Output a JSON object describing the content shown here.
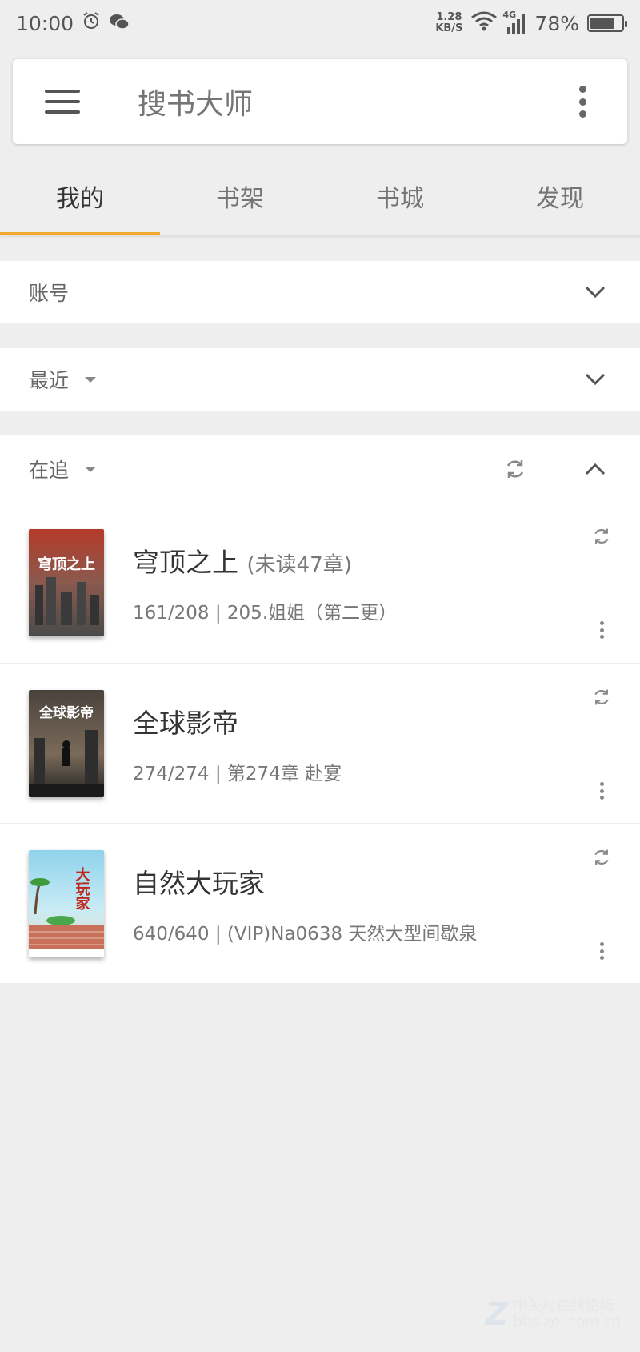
{
  "status_bar": {
    "time": "10:00",
    "net_speed_value": "1.28",
    "net_speed_unit": "KB/S",
    "network": "4G",
    "battery": "78%",
    "battery_level": 0.78
  },
  "header": {
    "title": "搜书大师"
  },
  "tabs": [
    {
      "label": "我的",
      "active": true
    },
    {
      "label": "书架",
      "active": false
    },
    {
      "label": "书城",
      "active": false
    },
    {
      "label": "发现",
      "active": false
    }
  ],
  "sections": {
    "account": {
      "label": "账号"
    },
    "recent": {
      "label": "最近"
    },
    "following": {
      "label": "在追"
    }
  },
  "books": [
    {
      "title": "穹顶之上",
      "unread": "(未读47章)",
      "progress": "161/208 | 205.姐姐（第二更）",
      "cover_text": "穹顶之上",
      "cover_colors": [
        "#b43a2a",
        "#6d6d6d"
      ]
    },
    {
      "title": "全球影帝",
      "unread": "",
      "progress": "274/274 | 第274章 赴宴",
      "cover_text": "全球影帝",
      "cover_colors": [
        "#5a4e44",
        "#2a2a2a"
      ]
    },
    {
      "title": "自然大玩家",
      "unread": "",
      "progress": "640/640 | (VIP)Na0638 天然大型间歇泉",
      "cover_text": "大玩家",
      "cover_colors": [
        "#7ec8e3",
        "#c86a4e"
      ]
    }
  ],
  "watermark": {
    "brand": "中关村在线论坛",
    "url": "bbs.zol.com.cn"
  },
  "colors": {
    "accent": "#f0a830",
    "background": "#eeeeee"
  }
}
